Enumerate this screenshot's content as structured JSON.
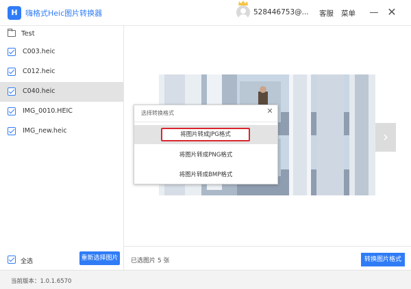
{
  "app": {
    "logo_glyph": "H",
    "title": "嗨格式Heic图片转换器"
  },
  "header": {
    "username": "528446753@...",
    "service_label": "客服",
    "menu_label": "菜单",
    "crown_color": "#f6c544"
  },
  "sidebar": {
    "folder_label": "Test",
    "files": [
      {
        "name": "C003.heic",
        "checked": true,
        "selected": false
      },
      {
        "name": "C012.heic",
        "checked": true,
        "selected": false
      },
      {
        "name": "C040.heic",
        "checked": true,
        "selected": true
      },
      {
        "name": "IMG_0010.HEIC",
        "checked": true,
        "selected": false
      },
      {
        "name": "IMG_new.heic",
        "checked": true,
        "selected": false
      }
    ],
    "select_all_label": "全选",
    "reselect_button_label": "重新选择图片"
  },
  "main": {
    "selected_count_text": "已选图片 5 张",
    "convert_button_label": "转换图片格式"
  },
  "dialog": {
    "title": "选择转换格式",
    "options": [
      {
        "label": "将图片转成JPG格式",
        "highlighted": true
      },
      {
        "label": "将图片转成PNG格式",
        "highlighted": false
      },
      {
        "label": "将图片转成BMP格式",
        "highlighted": false
      }
    ]
  },
  "footer": {
    "version_text": "当前版本：1.0.1.6570"
  },
  "colors": {
    "accent": "#2f7cf6",
    "highlight_border": "#d9262d"
  }
}
